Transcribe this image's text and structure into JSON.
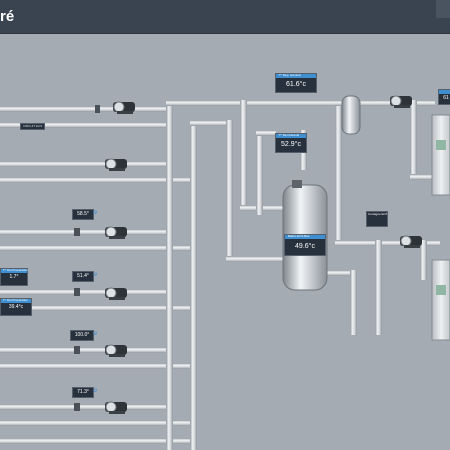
{
  "header": {
    "title_fragment": "ré"
  },
  "colors": {
    "pipe": "#c9ccd1",
    "pipe_edge": "#8e949b",
    "background": "#a4abb3",
    "widget_bg": "#27313d",
    "accent": "#3f8fd0",
    "header_bg": "#3a4350"
  },
  "tag_label": "CIRCUIT ECS",
  "widgets": {
    "supply_top": {
      "label": "T° Dép. Général",
      "value": "61.6°c"
    },
    "return_general": {
      "label": "T° Ret Général",
      "value": "52.9°c"
    },
    "tank": {
      "label": "Ballon ECS Bas",
      "value": "49.6°c"
    },
    "right_top": {
      "label": "Temp",
      "value": "61"
    },
    "right_mid": {
      "label": "Consigne ECS",
      "value": ""
    },
    "circuit_1": {
      "value": "58.5°"
    },
    "circuit_2": {
      "value": "51.4°"
    },
    "circuit_3": {
      "value": "100.0°"
    },
    "circuit_4": {
      "value": "71.3°"
    },
    "left_1": {
      "label": "T° Ret Préparation",
      "value": "1.7°"
    },
    "left_2": {
      "label": "T° Ret Préparation",
      "value": "39.4°c"
    }
  }
}
